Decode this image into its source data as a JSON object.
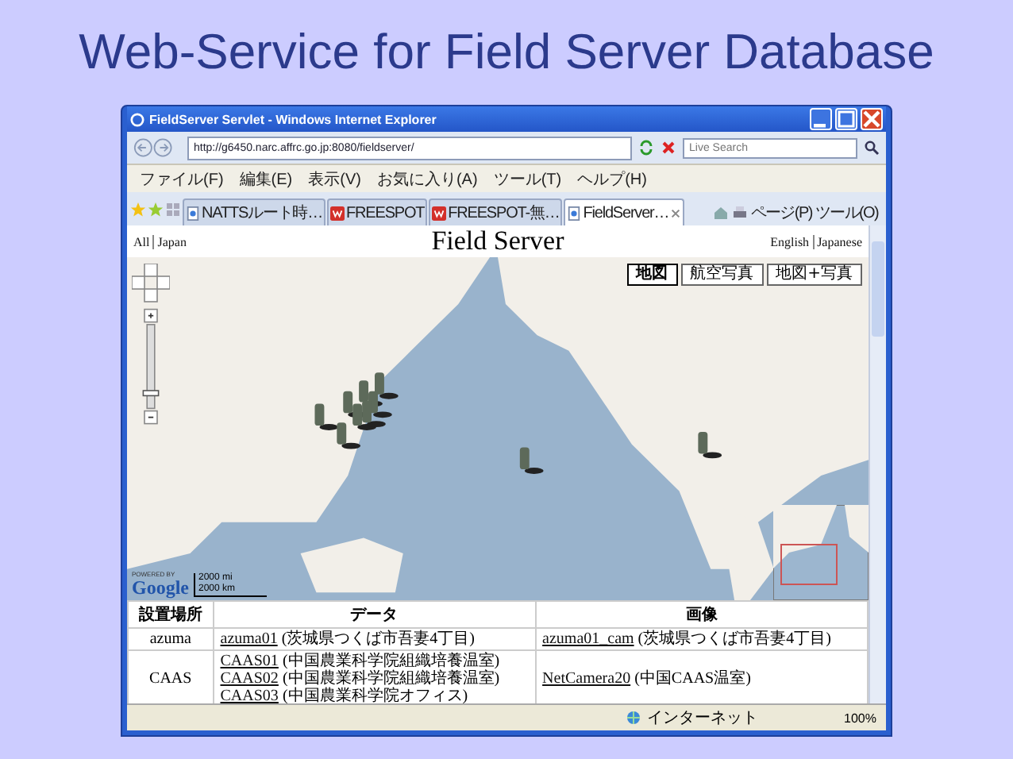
{
  "slide_title": "Web-Service for Field Server Database",
  "browser": {
    "title": "FieldServer Servlet - Windows Internet Explorer",
    "url": "http://g6450.narc.affrc.go.jp:8080/fieldserver/",
    "search": {
      "placeholder": "Live Search"
    },
    "menu": [
      "ファイル(F)",
      "編集(E)",
      "表示(V)",
      "お気に入り(A)",
      "ツール(T)",
      "ヘルプ(H)"
    ],
    "tabs": [
      {
        "label": "NATTSルート時…",
        "kind": "page",
        "selected": false
      },
      {
        "label": "FREESPOT",
        "kind": "freespot",
        "selected": false
      },
      {
        "label": "FREESPOT-無…",
        "kind": "freespot",
        "selected": false
      },
      {
        "label": "FieldServer…",
        "kind": "page",
        "selected": true
      }
    ],
    "toolbar": [
      "ページ(P)",
      "ツール(O)"
    ],
    "status": {
      "zone": "インターネット",
      "zoom": "100%"
    }
  },
  "page": {
    "nav_links": [
      "All",
      "Japan"
    ],
    "heading": "Field Server",
    "lang_links": [
      "English",
      "Japanese"
    ],
    "map": {
      "type_buttons": [
        {
          "label": "地図",
          "selected": true
        },
        {
          "label": "航空写真",
          "selected": false
        },
        {
          "label": "地図+写真",
          "selected": false
        }
      ],
      "powered_by": "POWERED BY",
      "logo": "Google",
      "scale": [
        "2000 mi",
        "2000 km"
      ]
    },
    "table": {
      "columns": [
        "設置場所",
        "データ",
        "画像"
      ],
      "rows": [
        {
          "location": "azuma",
          "data": [
            {
              "link": "azuma01",
              "text": "(茨城県つくば市吾妻4丁目)"
            }
          ],
          "images": [
            {
              "link": "azuma01_cam",
              "text": "(茨城県つくば市吾妻4丁目)"
            }
          ]
        },
        {
          "location": "CAAS",
          "data": [
            {
              "link": "CAAS01",
              "text": "(中国農業科学院組織培養温室)"
            },
            {
              "link": "CAAS02",
              "text": "(中国農業科学院組織培養温室)"
            },
            {
              "link": "CAAS03",
              "text": "(中国農業科学院オフィス)"
            }
          ],
          "images": [
            {
              "link": "NetCamera20",
              "text": "(中国CAAS温室)"
            }
          ]
        }
      ]
    }
  }
}
